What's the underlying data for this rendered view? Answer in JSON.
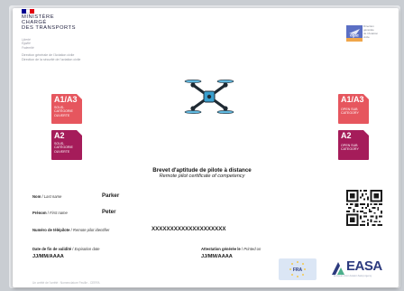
{
  "ministry": {
    "name_lines": [
      "MINISTÈRE",
      "CHARGÉ",
      "DES TRANSPORTS"
    ],
    "motto_lines": [
      "Liberté",
      "Égalité",
      "Fraternité"
    ],
    "flag_colors": [
      "#000091",
      "#ffffff",
      "#e1000f"
    ]
  },
  "dgac_block": {
    "line1": "Direction générale de l'Aviation civile",
    "line2": "Direction de la sécurité de l'aviation civile"
  },
  "dgac_logo": {
    "label": "dgac",
    "side_text": [
      "Direction",
      "générale",
      "de l'Aviation",
      "civile"
    ],
    "colors": [
      "#5b6fc4",
      "#f0a64a"
    ]
  },
  "categories_left": [
    {
      "code": "A1/A3",
      "sub_lines": [
        "SOUS-",
        "CATÉGORIE",
        "OUVERTE"
      ],
      "color": "#e6565e"
    },
    {
      "code": "A2",
      "sub_lines": [
        "SOUS-",
        "CATÉGORIE",
        "OUVERTE"
      ],
      "color": "#a51c5a"
    }
  ],
  "categories_right": [
    {
      "code": "A1/A3",
      "sub_lines": [
        "OPEN SUB",
        "CATEGORY"
      ],
      "color": "#e6565e"
    },
    {
      "code": "A2",
      "sub_lines": [
        "OPEN SUB",
        "CATEGORY"
      ],
      "color": "#a51c5a"
    }
  ],
  "certificate": {
    "title_fr": "Brevet d'aptitude de pilote à distance",
    "title_en": "Remote pilot certificate of competency"
  },
  "fields": {
    "nom_label_fr": "Nom",
    "nom_label_en": "Last name",
    "nom_value": "Parker",
    "prenom_label_fr": "Prénom",
    "prenom_label_en": "First name",
    "prenom_value": "Peter",
    "telepilote_label_fr": "Numéro de télépilote",
    "telepilote_label_en": "Remote pilot identifier",
    "telepilote_value": "XXXXXXXXXXXXXXXXXXXX",
    "validite_label_fr": "Date de fin de validité",
    "validite_label_en": "Expiration date",
    "validite_value": "JJ/MM/AAAA",
    "attestation_label_fr": "Attestation générée le",
    "attestation_label_en": "Printed on",
    "attestation_value": "JJ/MM/AAAA"
  },
  "fra_badge": {
    "label": "FRA"
  },
  "easa": {
    "name": "EASA",
    "subtitle": "European Union Aviation Safety Agency",
    "color": "#2c3a7e"
  },
  "footer": {
    "text": "Un arrêté de l'arrêté : Nomenclature Feuille - CERFA"
  }
}
